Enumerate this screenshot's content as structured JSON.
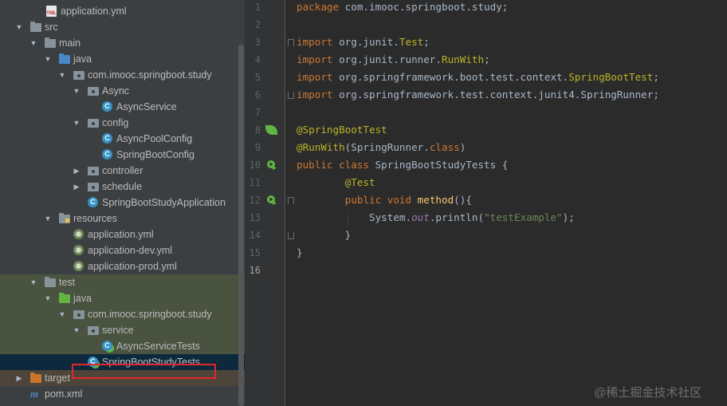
{
  "project_tree": {
    "rows": [
      {
        "label": "application.yml",
        "icon": "yml-icon",
        "indent": 58,
        "arrow": ""
      },
      {
        "label": "src",
        "icon": "folder-icon",
        "indent": 38,
        "arrow": "open"
      },
      {
        "label": "main",
        "icon": "folder-icon",
        "indent": 56,
        "arrow": "open"
      },
      {
        "label": "java",
        "icon": "source-folder-icon",
        "indent": 74,
        "arrow": "open"
      },
      {
        "label": "com.imooc.springboot.study",
        "icon": "package-icon",
        "indent": 92,
        "arrow": "open"
      },
      {
        "label": "Async",
        "icon": "package-icon",
        "indent": 110,
        "arrow": "open"
      },
      {
        "label": "AsyncService",
        "icon": "class-icon",
        "indent": 128,
        "arrow": ""
      },
      {
        "label": "config",
        "icon": "package-icon",
        "indent": 110,
        "arrow": "open"
      },
      {
        "label": "AsyncPoolConfig",
        "icon": "class-icon",
        "indent": 128,
        "arrow": ""
      },
      {
        "label": "SpringBootConfig",
        "icon": "class-icon",
        "indent": 128,
        "arrow": ""
      },
      {
        "label": "controller",
        "icon": "package-icon",
        "indent": 110,
        "arrow": "closed"
      },
      {
        "label": "schedule",
        "icon": "package-icon",
        "indent": 110,
        "arrow": "closed"
      },
      {
        "label": "SpringBootStudyApplication",
        "icon": "spring-boot-class-icon",
        "indent": 110,
        "arrow": ""
      },
      {
        "label": "resources",
        "icon": "resources-folder-icon",
        "indent": 74,
        "arrow": "open"
      },
      {
        "label": "application.yml",
        "icon": "spring-yml-icon",
        "indent": 92,
        "arrow": ""
      },
      {
        "label": "application-dev.yml",
        "icon": "spring-yml-icon",
        "indent": 92,
        "arrow": ""
      },
      {
        "label": "application-prod.yml",
        "icon": "spring-yml-icon",
        "indent": 92,
        "arrow": ""
      },
      {
        "label": "test",
        "icon": "folder-icon",
        "indent": 56,
        "arrow": "open"
      },
      {
        "label": "java",
        "icon": "test-source-folder-icon",
        "indent": 74,
        "arrow": "open"
      },
      {
        "label": "com.imooc.springboot.study",
        "icon": "package-icon",
        "indent": 92,
        "arrow": "open"
      },
      {
        "label": "service",
        "icon": "package-icon",
        "indent": 110,
        "arrow": "open"
      },
      {
        "label": "AsyncServiceTests",
        "icon": "test-class-icon",
        "indent": 128,
        "arrow": ""
      },
      {
        "label": "SpringBootStudyTests",
        "icon": "test-class-icon",
        "indent": 110,
        "arrow": "",
        "selected": true
      },
      {
        "label": "target",
        "icon": "excluded-folder-icon",
        "indent": 38,
        "arrow": "closed"
      },
      {
        "label": "pom.xml",
        "icon": "maven-icon",
        "indent": 38,
        "arrow": ""
      }
    ]
  },
  "editor": {
    "current_line": 16,
    "lines": [
      {
        "n": "1",
        "tokens": [
          [
            "kw",
            "package "
          ],
          [
            "",
            "com.imooc.springboot.study;"
          ]
        ]
      },
      {
        "n": "2",
        "tokens": []
      },
      {
        "n": "3",
        "tokens": [
          [
            "kw",
            "import "
          ],
          [
            "",
            "org.junit."
          ],
          [
            "typ",
            "Test"
          ],
          [
            "",
            ";"
          ]
        ],
        "fold": "start"
      },
      {
        "n": "4",
        "tokens": [
          [
            "kw",
            "import "
          ],
          [
            "",
            "org.junit.runner."
          ],
          [
            "typ",
            "RunWith"
          ],
          [
            "",
            ";"
          ]
        ]
      },
      {
        "n": "5",
        "tokens": [
          [
            "kw",
            "import "
          ],
          [
            "",
            "org.springframework.boot.test.context."
          ],
          [
            "typ",
            "SpringBootTest"
          ],
          [
            "",
            ";"
          ]
        ]
      },
      {
        "n": "6",
        "tokens": [
          [
            "kw",
            "import "
          ],
          [
            "",
            "org.springframework.test.context.junit4.SpringRunner;"
          ]
        ],
        "fold": "end"
      },
      {
        "n": "7",
        "tokens": []
      },
      {
        "n": "8",
        "tokens": [
          [
            "ann",
            "@SpringBootTest"
          ]
        ],
        "gutter": "spring-bean-icon"
      },
      {
        "n": "9",
        "tokens": [
          [
            "ann",
            "@RunWith"
          ],
          [
            "",
            "(SpringRunner."
          ],
          [
            "kw",
            "class"
          ],
          [
            "",
            ")"
          ]
        ]
      },
      {
        "n": "10",
        "tokens": [
          [
            "kw",
            "public class "
          ],
          [
            "",
            "SpringBootStudyTests {"
          ]
        ],
        "gutter": "run-tests-icon"
      },
      {
        "n": "11",
        "tokens": [
          [
            "",
            "        "
          ],
          [
            "ann",
            "@Test"
          ]
        ]
      },
      {
        "n": "12",
        "tokens": [
          [
            "",
            "        "
          ],
          [
            "kw",
            "public void "
          ],
          [
            "fn",
            "method"
          ],
          [
            "",
            "(){"
          ]
        ],
        "gutter": "run-test-icon",
        "fold": "start"
      },
      {
        "n": "13",
        "tokens": [
          [
            "",
            "            System."
          ],
          [
            "fld",
            "out"
          ],
          [
            "",
            ".println("
          ],
          [
            "str",
            "\"testExample\""
          ],
          [
            "",
            ");"
          ]
        ]
      },
      {
        "n": "14",
        "tokens": [
          [
            "",
            "        }"
          ]
        ],
        "fold": "end"
      },
      {
        "n": "15",
        "tokens": [
          [
            "",
            "}"
          ]
        ]
      },
      {
        "n": "16",
        "tokens": []
      }
    ]
  },
  "watermark": "@稀土掘金技术社区"
}
